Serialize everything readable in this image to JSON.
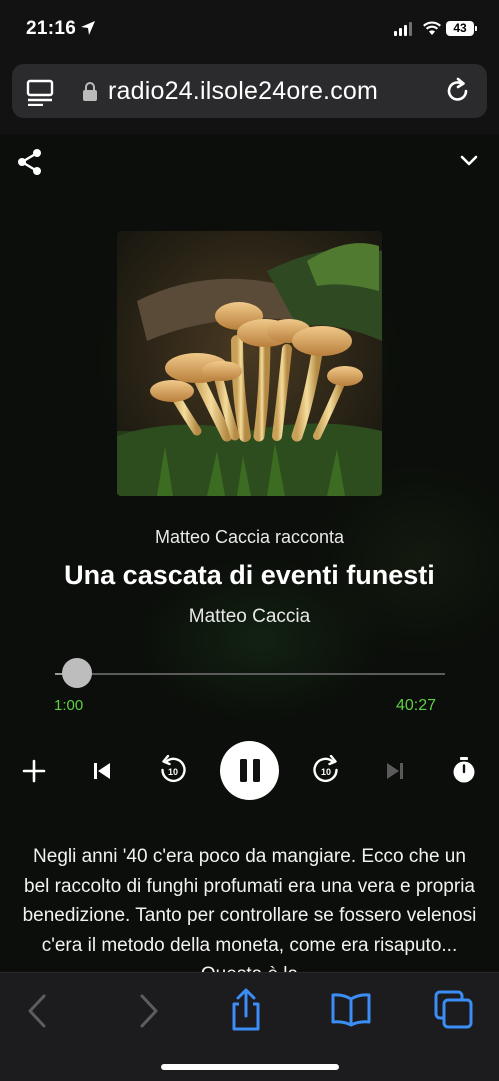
{
  "status_bar": {
    "time": "21:16",
    "battery": "43"
  },
  "browser": {
    "url": "radio24.ilsole24ore.com"
  },
  "player": {
    "podcast_name": "Matteo Caccia racconta",
    "episode_title": "Una cascata di eventi funesti",
    "author": "Matteo Caccia",
    "elapsed": "1:00",
    "total": "40:27",
    "progress": 0.025,
    "skip_back_seconds": "10",
    "skip_forward_seconds": "10",
    "description": "Negli anni '40 c'era poco da mangiare. Ecco che un bel raccolto di funghi profumati era una vera e propria benedizione. Tanto per controllare se fossero velenosi c'era il metodo della moneta, come era risaputo... Questa è la"
  },
  "icons": {
    "share": "share-icon",
    "collapse": "chevron-down-icon",
    "add": "plus-icon",
    "previous": "skip-previous-icon",
    "rewind": "rewind-10-icon",
    "pause": "pause-icon",
    "forward": "forward-10-icon",
    "next": "skip-next-icon",
    "timer": "sleep-timer-icon"
  },
  "colors": {
    "accent_green": "#5fcf45",
    "safari_blue": "#3a8ef6"
  }
}
